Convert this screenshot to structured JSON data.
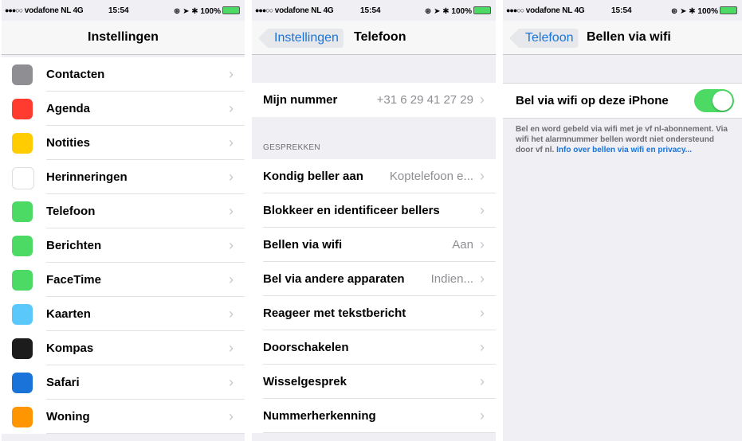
{
  "status_bar": {
    "carrier": "vodafone NL",
    "network": "4G",
    "time": "15:54",
    "battery": "100%"
  },
  "screen1": {
    "title": "Instellingen",
    "items": [
      {
        "label": "Contacten",
        "icon": "contacts-icon",
        "color": "#8e8e93"
      },
      {
        "label": "Agenda",
        "icon": "calendar-icon",
        "color": "#ff3b30"
      },
      {
        "label": "Notities",
        "icon": "notes-icon",
        "color": "#ffcc00"
      },
      {
        "label": "Herinneringen",
        "icon": "reminders-icon",
        "color": "#ffffff"
      },
      {
        "label": "Telefoon",
        "icon": "phone-icon",
        "color": "#4cd964"
      },
      {
        "label": "Berichten",
        "icon": "messages-icon",
        "color": "#4cd964"
      },
      {
        "label": "FaceTime",
        "icon": "facetime-icon",
        "color": "#4cd964"
      },
      {
        "label": "Kaarten",
        "icon": "maps-icon",
        "color": "#5ac8fa"
      },
      {
        "label": "Kompas",
        "icon": "compass-icon",
        "color": "#1c1c1c"
      },
      {
        "label": "Safari",
        "icon": "safari-icon",
        "color": "#1a73d9"
      },
      {
        "label": "Woning",
        "icon": "home-icon",
        "color": "#ff9500"
      }
    ]
  },
  "screen2": {
    "back": "Instellingen",
    "title": "Telefoon",
    "my_number": {
      "label": "Mijn nummer",
      "value": "+31 6 29 41 27 29"
    },
    "section_header": "GESPREKKEN",
    "items": [
      {
        "label": "Kondig beller aan",
        "value": "Koptelefoon e..."
      },
      {
        "label": "Blokkeer en identificeer bellers",
        "value": ""
      },
      {
        "label": "Bellen via wifi",
        "value": "Aan"
      },
      {
        "label": "Bel via andere apparaten",
        "value": "Indien..."
      },
      {
        "label": "Reageer met tekstbericht",
        "value": ""
      },
      {
        "label": "Doorschakelen",
        "value": ""
      },
      {
        "label": "Wisselgesprek",
        "value": ""
      },
      {
        "label": "Nummerherkenning",
        "value": ""
      }
    ]
  },
  "screen3": {
    "back": "Telefoon",
    "title": "Bellen via wifi",
    "toggle_label": "Bel via wifi op deze iPhone",
    "toggle_on": true,
    "footer_text": "Bel en word gebeld via wifi met je vf nl-abonnement. Via wifi het alarmnummer bellen wordt niet ondersteund door vf nl. ",
    "footer_link": "Info over bellen via wifi en privacy..."
  },
  "colors": {
    "accent": "#1a73d9",
    "toggle_on": "#4cd964",
    "background": "#efeff4"
  }
}
